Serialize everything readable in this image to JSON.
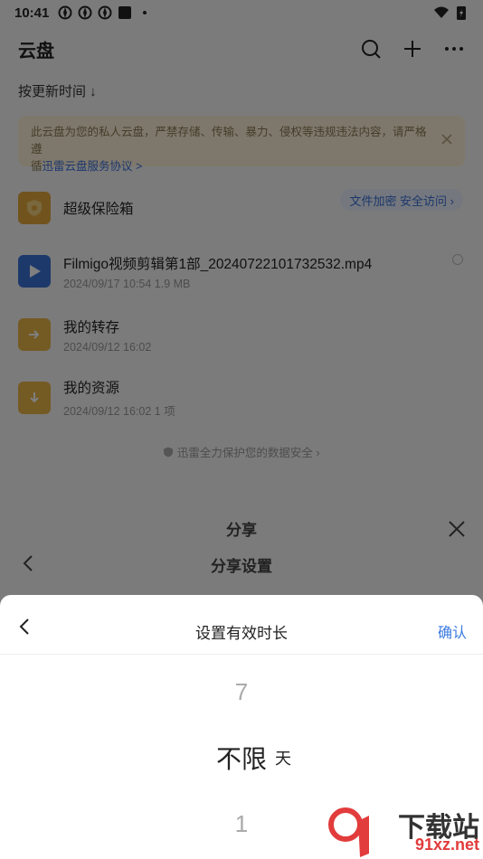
{
  "status_bar": {
    "time": "10:41"
  },
  "header": {
    "title": "云盘"
  },
  "sort": {
    "label": "按更新时间 ↓"
  },
  "notice": {
    "text": "此云盘为您的私人云盘，严禁存储、传输、暴力、侵权等违规违法内容，请严格遵",
    "text2_prefix": "循",
    "link": "迅雷云盘服务协议 >"
  },
  "files": [
    {
      "name": "超级保险箱",
      "meta": "",
      "badge": "文件加密 安全访问 ›"
    },
    {
      "name": "Filmigo视频剪辑第1部_20240722101732532.mp4",
      "meta": "2024/09/17 10:54  1.9 MB"
    },
    {
      "name": "我的转存",
      "meta": "2024/09/12 16:02"
    },
    {
      "name": "我的资源",
      "meta": "2024/09/12 16:02  1 项"
    }
  ],
  "protect_note": "迅雷全力保护您的数据安全 ›",
  "share": {
    "title": "分享",
    "settings": "分享设置"
  },
  "sheet": {
    "title": "设置有效时长",
    "confirm": "确认",
    "picker": {
      "above": "7",
      "selected": "不限",
      "below": "1",
      "unit": "天"
    }
  },
  "watermark": {
    "text": "下载站",
    "url": "91xz.net"
  },
  "colors": {
    "accent": "#3a7be0",
    "vault": "#e3a93a",
    "video": "#3b72d6",
    "folder": "#e8b447"
  }
}
